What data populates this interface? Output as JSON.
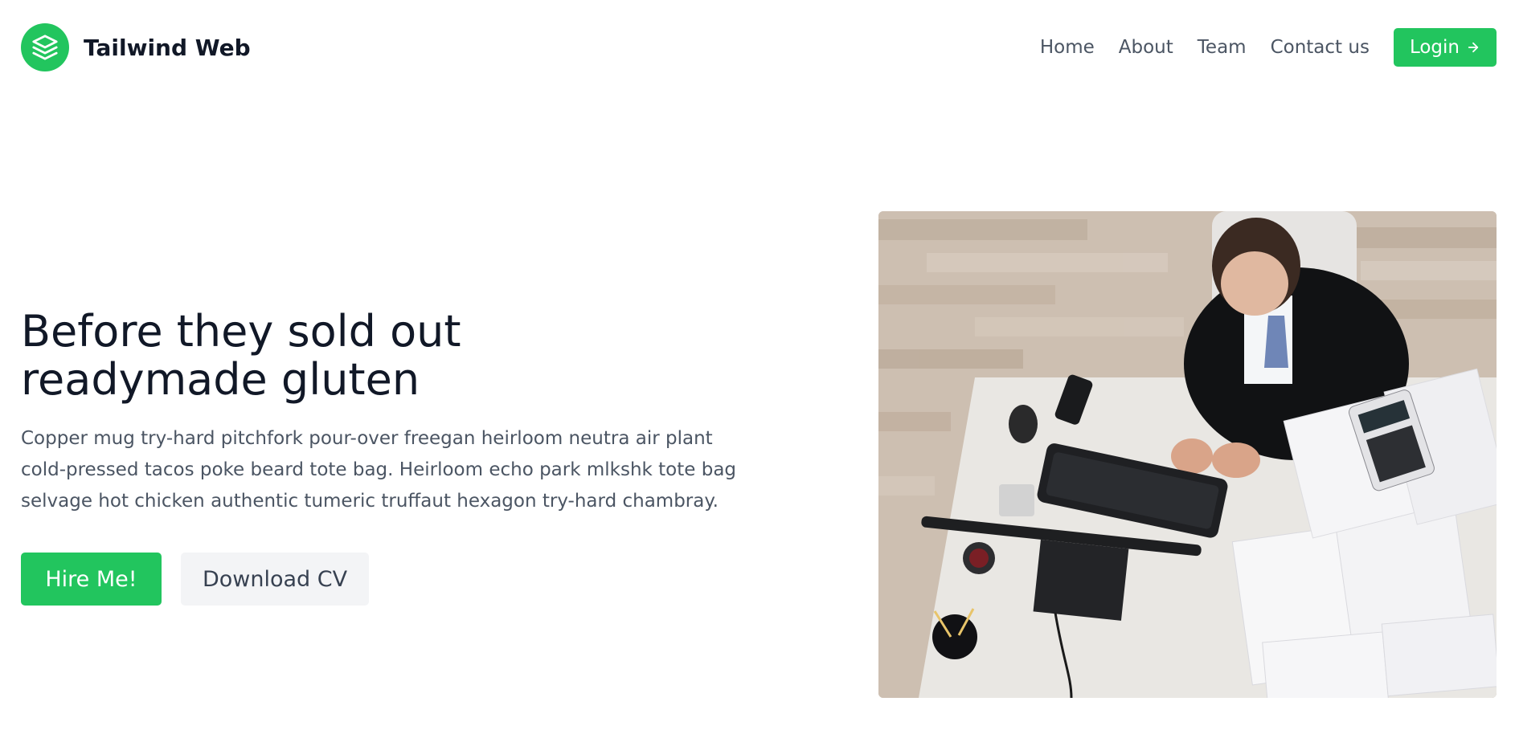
{
  "brand": {
    "name": "Tailwind Web",
    "logo_icon": "layers-icon",
    "accent_color": "#22c55e"
  },
  "nav": {
    "items": [
      {
        "label": "Home"
      },
      {
        "label": "About"
      },
      {
        "label": "Team"
      },
      {
        "label": "Contact us"
      }
    ],
    "login_label": "Login",
    "login_icon": "arrow-right-icon"
  },
  "hero": {
    "headline_line1": "Before they sold out",
    "headline_line2": "readymade gluten",
    "description": "Copper mug try-hard pitchfork pour-over freegan heirloom neutra air plant cold-pressed tacos poke beard tote bag. Heirloom echo park mlkshk tote bag selvage hot chicken authentic tumeric truffaut hexagon try-hard chambray.",
    "primary_button": "Hire Me!",
    "secondary_button": "Download CV",
    "image_alt": "businessman working at office desk with keyboard and documents"
  }
}
